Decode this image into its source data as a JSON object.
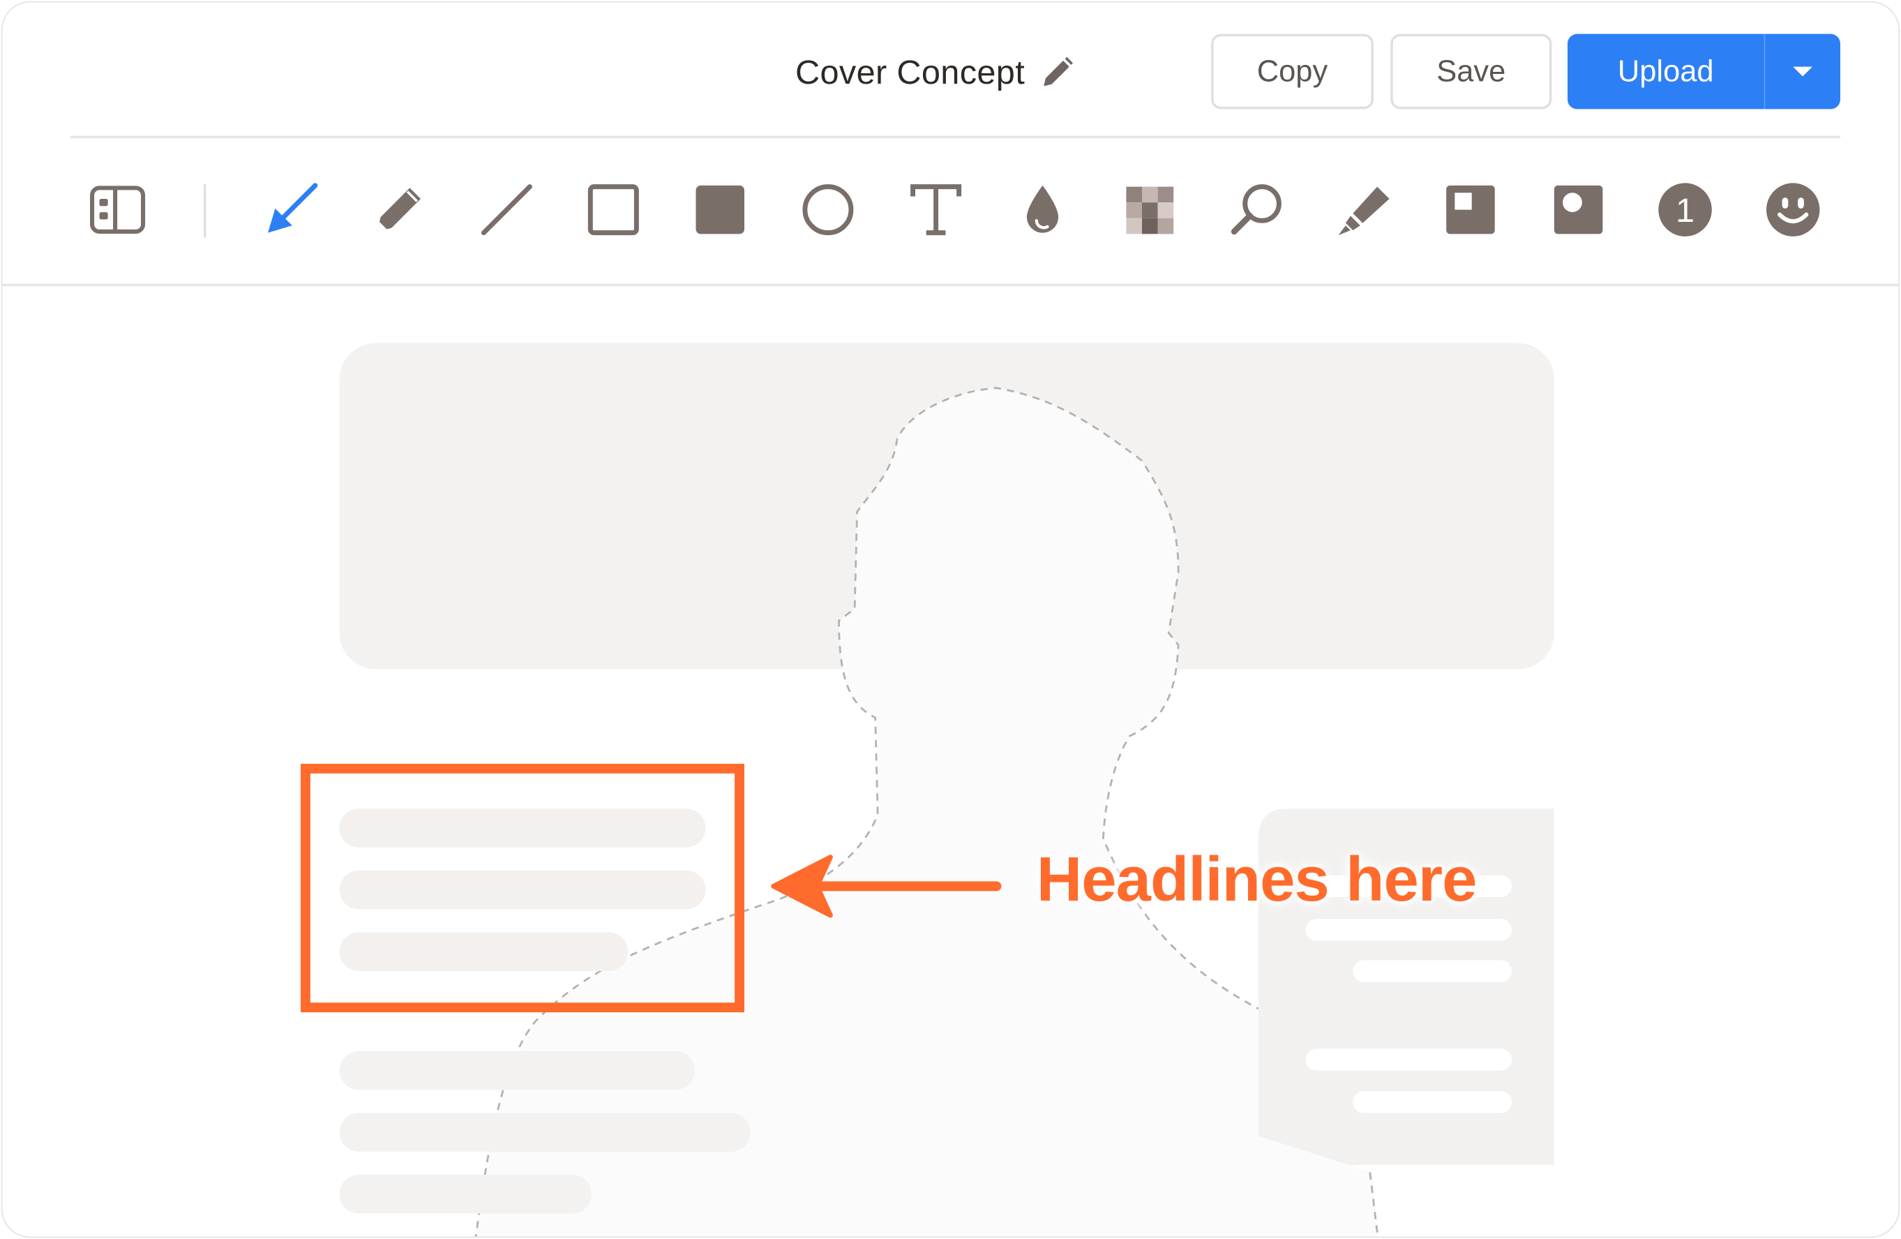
{
  "header": {
    "title": "Cover Concept",
    "edit_icon": "pencil-icon",
    "copy_label": "Copy",
    "save_label": "Save",
    "upload_label": "Upload",
    "upload_menu_icon": "chevron-down-icon"
  },
  "toolbar": {
    "tools": [
      {
        "name": "sidebar-toggle",
        "icon": "panel-icon"
      },
      {
        "name": "arrow",
        "icon": "arrow-icon",
        "selected": true,
        "color": "#2d7ff5"
      },
      {
        "name": "pen",
        "icon": "pencil-icon"
      },
      {
        "name": "line",
        "icon": "line-icon"
      },
      {
        "name": "rectangle",
        "icon": "rectangle-outline-icon"
      },
      {
        "name": "filled-rectangle",
        "icon": "rectangle-filled-icon"
      },
      {
        "name": "ellipse",
        "icon": "circle-outline-icon"
      },
      {
        "name": "text",
        "icon": "text-icon"
      },
      {
        "name": "blur",
        "icon": "droplet-icon"
      },
      {
        "name": "pixelate",
        "icon": "pixelate-icon"
      },
      {
        "name": "magnify",
        "icon": "magnifier-icon"
      },
      {
        "name": "highlighter",
        "icon": "highlighter-icon"
      },
      {
        "name": "spotlight",
        "icon": "spotlight-square-icon"
      },
      {
        "name": "spotlight-round",
        "icon": "spotlight-circle-icon"
      },
      {
        "name": "counter",
        "icon": "counter-icon",
        "label": "1"
      },
      {
        "name": "emoji",
        "icon": "smiley-icon"
      }
    ]
  },
  "annotation": {
    "text": "Headlines here",
    "color": "#ff6b2c"
  },
  "colors": {
    "accent": "#2d7ff5",
    "icon": "#7a6e69",
    "annotation": "#ff6b2c"
  }
}
